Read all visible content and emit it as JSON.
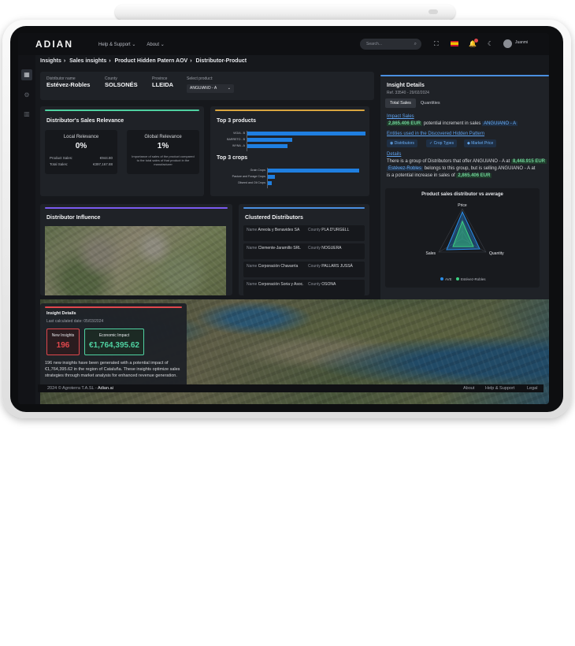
{
  "app": {
    "logo": "ADIAN",
    "nav": [
      "Help & Support ⌄",
      "About ⌄"
    ],
    "search_placeholder": "Search...",
    "user": "Juanmi"
  },
  "breadcrumb": [
    "Insights",
    "Sales insights",
    "Product Hidden Patern AOV",
    "Distributor-Product"
  ],
  "info": {
    "distributor_label": "Distributor name",
    "distributor": "Estévez-Robles",
    "county_label": "County",
    "county": "SOLSONÉS",
    "province_label": "Province",
    "province": "LLEIDA",
    "product_label": "Select product:",
    "product": "ANGUIANO - A"
  },
  "relevance": {
    "title": "Distributor's Sales Relevance",
    "local_title": "Local Relevance",
    "local_value": "0%",
    "product_sales_label": "Product Sales:",
    "product_sales_value": "€944.80",
    "total_sales_label": "Total Sales:",
    "total_sales_value": "€397,167.88",
    "global_title": "Global Relevance",
    "global_value": "1%",
    "global_desc": "Importance of sales of the product compared to the total sales of that product in the manufacturer",
    "accent": "#4fd1a1"
  },
  "top_products": {
    "title": "Top 3 products",
    "items": [
      {
        "label": "VIGIA - B",
        "value": 100
      },
      {
        "label": "BARRETO - B",
        "value": 38
      },
      {
        "label": "WYNA - A",
        "value": 34
      }
    ],
    "crops_title": "Top 3 crops",
    "crops": [
      {
        "label": "Grain Crops",
        "value": 100
      },
      {
        "label": "Pasture and Forage Crops",
        "value": 8
      },
      {
        "label": "Oilseed and Oil Crops",
        "value": 4
      }
    ],
    "accent": "#d9a63f",
    "bar_color": "#1f7fe0"
  },
  "insight_right": {
    "title": "Insight Details",
    "ref": "Ref. 33540 - 29/02/2024",
    "tabs": [
      "Total Sales",
      "Quantities"
    ],
    "impact_link": "Impact Sales",
    "impact_value": "2,865.406 EUR",
    "impact_text": "potential increment in sales",
    "impact_product": "ANGUIANO - A",
    "entities_link": "Entities used in the Discovered Hidden Pattern",
    "chips": [
      "Distributors",
      "Crop Types",
      "Market Price"
    ],
    "details_link": "Details",
    "details_line1": "There is a group of Distributors that offer ANGUIANO - A at",
    "details_price": "8,448.915 EUR",
    "details_name": "Estévez-Robles",
    "details_line2": "belongs to this group, but is selling ANGUIANO - A at",
    "details_line3": "is a potential increase in sales of",
    "details_increase": "2,865.406 EUR",
    "radar_title": "Product sales distributor vs average",
    "radar_axes": [
      "Price",
      "Quantity",
      "Sales"
    ],
    "legend": [
      "AVE",
      "Estévez-Robles"
    ]
  },
  "influence": {
    "title": "Distributor Influence",
    "accent": "#7a5af0"
  },
  "clustered": {
    "title": "Clustered Distributors",
    "name_label": "Name",
    "county_label": "County",
    "rows": [
      {
        "name": "Arreola y Benavides SA",
        "county": "PLA D'URGELL"
      },
      {
        "name": "Clemente-Jaramillo SRL",
        "county": "NOGUERA"
      },
      {
        "name": "Corporación Chavarría",
        "county": "PALLARS JUSSÀ"
      },
      {
        "name": "Corporación Soria y Asoc.",
        "county": "OSONA"
      }
    ],
    "accent": "#4a8fe0"
  },
  "overlay": {
    "title": "Insight Details",
    "date": "Last calculated date: 05/03/2024",
    "new_label": "New Insights",
    "new_value": "196",
    "econ_label": "Economic Impact",
    "econ_value": "€1,764,395.62",
    "desc": "196 new insights have been generated with a potential impact of €1,764,395.62 in the region of Cataluña. These insights optimize sales strategies through market analysis for enhanced revenue generation.",
    "accent": "#e0474c"
  },
  "footer": {
    "copyright": "2024 © Agroterra T.A.SL - ",
    "brand": "Adian.ai",
    "links": [
      "About",
      "Help & Support",
      "Legal"
    ]
  }
}
